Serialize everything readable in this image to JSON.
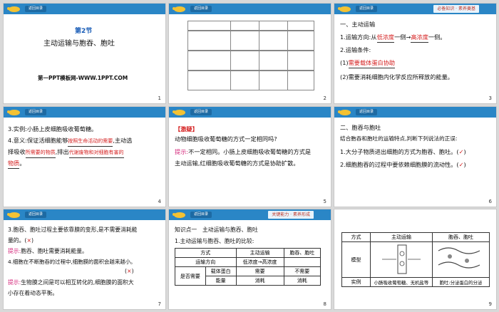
{
  "header": {
    "button_label": "返回目录",
    "tag_knowledge": "必备知识 · 素养奠基",
    "tag_ability": "关键能力 · 素养形成"
  },
  "slide1": {
    "section": "第2节",
    "title": "主动运输与胞吞、胞吐",
    "watermark": "第一PPT模板网-WWW.1PPT.COM",
    "num": "1"
  },
  "slide2": {
    "num": "2"
  },
  "slide3": {
    "heading": "一、主动运输",
    "line1_prefix": "1.运输方向:从",
    "line1_from": "低浓度",
    "line1_mid": "一侧→",
    "line1_to": "高浓度",
    "line1_suffix": "一侧。",
    "line2": "2.运输条件:",
    "line3_prefix": "(1)",
    "line3_answer": "需要载体蛋白协助",
    "line4": "(2)需要消耗细胞内化学反应所释放的能量。",
    "num": "3"
  },
  "slide4": {
    "line1": "3.实例:小肠上皮细胞吸收葡萄糖。",
    "line2_prefix": "4.意义:保证活细胞能够",
    "line2_answer": "按照生命活动的需要",
    "line2_suffix": ",主动选",
    "line3_prefix": "择吸收",
    "line3_answer": "所需要的物质",
    "line3_mid": ",排出",
    "line3_answer2": "代谢废物和对细胞有害的",
    "line4_answer": "物质",
    "line4_suffix": "。",
    "num": "4"
  },
  "slide5": {
    "tag": "【激疑】",
    "q": "动物细胞吸收葡萄糖的方式一定相同吗?",
    "hint_label": "提示:",
    "hint1": "不一定相同。小肠上皮细胞吸收葡萄糖的方式是",
    "hint2": "主动运输,红细胞吸收葡萄糖的方式是协助扩散。",
    "num": "5"
  },
  "slide6": {
    "heading": "二、胞吞与胞吐",
    "intro": "结合胞吞和胞吐的运输特点,判断下列说法的正误:",
    "item1": "1.大分子物质进出细胞的方式为胞吞、胞吐。(",
    "item1_mark": "✓",
    "item1_end": ")",
    "item2": "2.细胞胞吞的过程中要依赖细胞膜的流动性。(",
    "item2_mark": "✓",
    "item2_end": ")",
    "num": "6"
  },
  "slide7": {
    "line1": "3.胞吞、胞吐过程主要依靠膜的变形,是不需要消耗能",
    "line2": "量的。",
    "mark1": "×",
    "hint_label": "提示:",
    "hint1": "胞吞、胞吐需要消耗能量。",
    "line3": "4.细胞在不断胞吞的过程中,细胞膜的面积会越来越小。",
    "mark2": "×",
    "hint2a": "生物膜之间是可以相互转化的,细胞膜的面积大",
    "hint2b": "小存在着动态平衡。",
    "num": "7"
  },
  "slide8": {
    "heading": "知识点一　主动运输与胞吞、胞吐",
    "sub": "1.主动运输与胞吞、胞吐的比较:",
    "table": {
      "h": [
        "方式",
        "主动运输",
        "胞吞、胞吐"
      ],
      "r1": [
        "运输方向",
        "低浓度→高浓度",
        ""
      ],
      "r2": [
        "是否需要",
        "载体蛋白",
        "需要",
        "不需要"
      ],
      "r3": [
        "能量",
        "消耗",
        "消耗"
      ]
    },
    "num": "8"
  },
  "slide9": {
    "table": {
      "h": [
        "方式",
        "主动运输",
        "胞吞、胞吐"
      ],
      "r1": [
        "模型"
      ],
      "r2": [
        "实例",
        "小肠吸收葡萄糖、无机盐等",
        "胞吐:分泌蛋白的分泌"
      ]
    },
    "num": "9"
  }
}
